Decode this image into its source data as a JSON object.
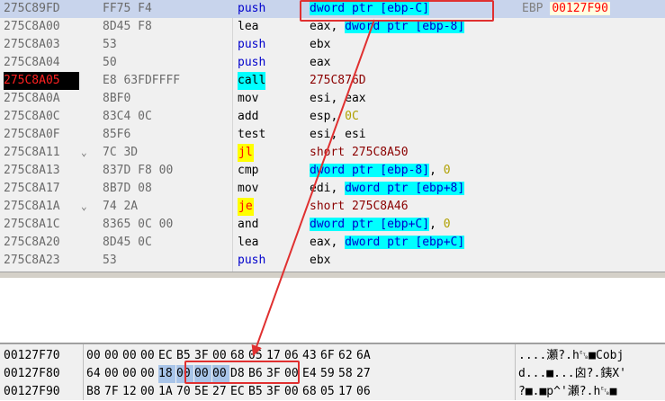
{
  "disassembly": {
    "rows": [
      {
        "addr": "275C89FD",
        "jm": "",
        "bytes": "FF75 F4",
        "mn": "push",
        "mnStyle": "blue",
        "ops": [
          {
            "t": "mem",
            "v": "dword ptr [ebp-C]"
          }
        ],
        "selected": true
      },
      {
        "addr": "275C8A00",
        "jm": "",
        "bytes": "8D45 F8",
        "mn": "lea",
        "mnStyle": "",
        "ops": [
          {
            "t": "t",
            "v": "eax, "
          },
          {
            "t": "mem",
            "v": "dword ptr [ebp-8]"
          }
        ]
      },
      {
        "addr": "275C8A03",
        "jm": "",
        "bytes": "53",
        "mn": "push",
        "mnStyle": "blue",
        "ops": [
          {
            "t": "t",
            "v": "ebx"
          }
        ]
      },
      {
        "addr": "275C8A04",
        "jm": "",
        "bytes": "50",
        "mn": "push",
        "mnStyle": "blue",
        "ops": [
          {
            "t": "t",
            "v": "eax"
          }
        ]
      },
      {
        "addr": "275C8A05",
        "jm": "",
        "bytes": "E8 63FDFFFF",
        "mn": "call",
        "mnStyle": "hl",
        "ops": [
          {
            "t": "lbl",
            "v": "275C876D"
          }
        ],
        "cur": true
      },
      {
        "addr": "275C8A0A",
        "jm": "",
        "bytes": "8BF0",
        "mn": "mov",
        "mnStyle": "",
        "ops": [
          {
            "t": "t",
            "v": "esi, eax"
          }
        ]
      },
      {
        "addr": "275C8A0C",
        "jm": "",
        "bytes": "83C4 0C",
        "mn": "add",
        "mnStyle": "",
        "ops": [
          {
            "t": "t",
            "v": "esp, "
          },
          {
            "t": "imm",
            "v": "0C"
          }
        ]
      },
      {
        "addr": "275C8A0F",
        "jm": "",
        "bytes": "85F6",
        "mn": "test",
        "mnStyle": "",
        "ops": [
          {
            "t": "t",
            "v": "esi, esi"
          }
        ]
      },
      {
        "addr": "275C8A11",
        "jm": "⌄",
        "bytes": "7C 3D",
        "mn": "jl",
        "mnStyle": "yel",
        "ops": [
          {
            "t": "lbl",
            "v": "short 275C8A50"
          }
        ]
      },
      {
        "addr": "275C8A13",
        "jm": "",
        "bytes": "837D F8 00",
        "mn": "cmp",
        "mnStyle": "",
        "ops": [
          {
            "t": "mem",
            "v": "dword ptr [ebp-8]"
          },
          {
            "t": "t",
            "v": ", "
          },
          {
            "t": "imm",
            "v": "0"
          }
        ]
      },
      {
        "addr": "275C8A17",
        "jm": "",
        "bytes": "8B7D 08",
        "mn": "mov",
        "mnStyle": "",
        "ops": [
          {
            "t": "t",
            "v": "edi, "
          },
          {
            "t": "mem",
            "v": "dword ptr [ebp+8]"
          }
        ]
      },
      {
        "addr": "275C8A1A",
        "jm": "⌄",
        "bytes": "74 2A",
        "mn": "je",
        "mnStyle": "yel",
        "ops": [
          {
            "t": "lbl",
            "v": "short 275C8A46"
          }
        ]
      },
      {
        "addr": "275C8A1C",
        "jm": "",
        "bytes": "8365 0C 00",
        "mn": "and",
        "mnStyle": "",
        "ops": [
          {
            "t": "mem",
            "v": "dword ptr [ebp+C]"
          },
          {
            "t": "t",
            "v": ", "
          },
          {
            "t": "imm",
            "v": "0"
          }
        ]
      },
      {
        "addr": "275C8A20",
        "jm": "",
        "bytes": "8D45 0C",
        "mn": "lea",
        "mnStyle": "",
        "ops": [
          {
            "t": "t",
            "v": "eax, "
          },
          {
            "t": "mem",
            "v": "dword ptr [ebp+C]"
          }
        ]
      },
      {
        "addr": "275C8A23",
        "jm": "",
        "bytes": "53",
        "mn": "push",
        "mnStyle": "blue",
        "ops": [
          {
            "t": "t",
            "v": "ebx"
          }
        ]
      }
    ],
    "partial_row": {
      "addr": "275C8A24",
      "bytes": "50"
    }
  },
  "register_tip": {
    "name": "EBP",
    "value": "00127F90"
  },
  "dump": {
    "rows": [
      {
        "addr": "00127F70",
        "hex": [
          "00",
          "00",
          "00",
          "00",
          "EC",
          "B5",
          "3F",
          "00",
          "68",
          "05",
          "17",
          "06",
          "43",
          "6F",
          "62",
          "6A"
        ],
        "ascii": "....瀬?.h␗■Cobj"
      },
      {
        "addr": "00127F80",
        "hex": [
          "64",
          "00",
          "00",
          "00",
          "18",
          "00",
          "00",
          "00",
          "D8",
          "B6",
          "3F",
          "00",
          "E4",
          "59",
          "58",
          "27"
        ],
        "ascii": "d...■...囟?.銕X'",
        "sel": [
          4,
          5,
          6,
          7
        ]
      },
      {
        "addr": "00127F90",
        "hex": [
          "B8",
          "7F",
          "12",
          "00",
          "1A",
          "70",
          "5E",
          "27",
          "EC",
          "B5",
          "3F",
          "00",
          "68",
          "05",
          "17",
          "06"
        ],
        "ascii": "?■.■p^'瀬?.h␗■"
      }
    ]
  },
  "annotation": {
    "color": "#e03030"
  }
}
